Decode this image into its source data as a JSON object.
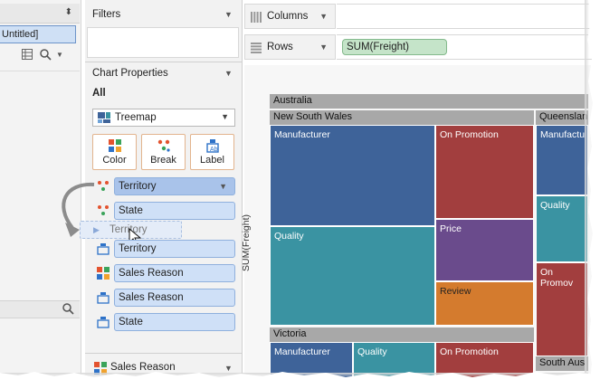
{
  "left": {
    "sheet_name": "Untitled]",
    "updown_glyph": "⬍"
  },
  "filters": {
    "title": "Filters"
  },
  "chart_properties": {
    "title": "Chart Properties",
    "all_label": "All",
    "mark_type": "Treemap",
    "buttons": [
      {
        "label": "Color"
      },
      {
        "label": "Break"
      },
      {
        "label": "Label"
      }
    ],
    "pills": [
      {
        "label": "Territory"
      },
      {
        "label": "State"
      },
      {
        "label": "Territory"
      },
      {
        "label": "Sales Reason"
      },
      {
        "label": "Sales Reason"
      },
      {
        "label": "State"
      }
    ],
    "drag_ghost_label": "Territory",
    "bottom_item": "Sales Reason"
  },
  "shelves": {
    "columns_label": "Columns",
    "rows_label": "Rows",
    "rows_pill": "SUM(Freight)"
  },
  "view": {
    "yaxis_label": "SUM(Freight)",
    "top_header": "Australia",
    "nsw_header": "New South Wales",
    "qld_header": "Queenslan",
    "vic_header": "Victoria",
    "sa_header": "South Aus",
    "cells": {
      "nsw_manufacturer": "Manufacturer",
      "nsw_quality": "Quality",
      "nsw_promotion": "On Promotion",
      "nsw_price": "Price",
      "nsw_review": "Review",
      "qld_manufacturer": "Manufactu",
      "qld_quality": "Quality",
      "qld_promotion": "On Promov",
      "vic_manufacturer": "Manufacturer",
      "vic_quality": "Quality",
      "vic_promotion": "On Promotion"
    }
  },
  "colors": {
    "manufacturer": "#3e6399",
    "quality": "#3a93a2",
    "promotion": "#a23e3e",
    "price": "#6a4b8c",
    "review": "#d47b2e",
    "pill_blue": "#cfe0f7",
    "pill_green": "#c5e4c9",
    "header_gray": "#a8a8a8"
  }
}
